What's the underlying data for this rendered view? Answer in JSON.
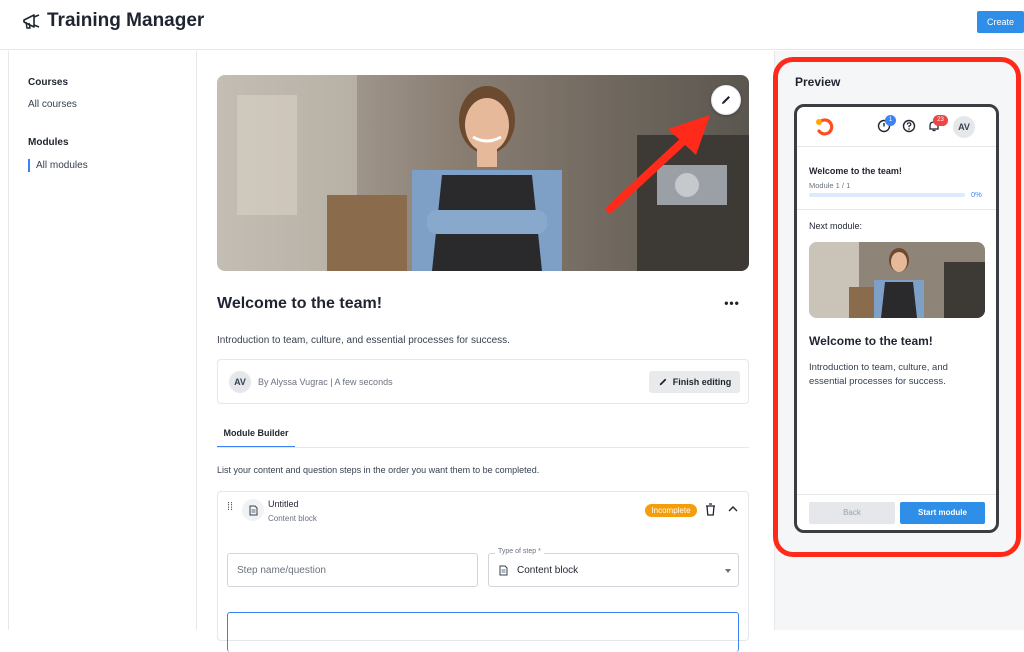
{
  "app": {
    "title": "Training Manager",
    "create_label": "Create"
  },
  "sidebar": {
    "courses_heading": "Courses",
    "courses_item": "All courses",
    "modules_heading": "Modules",
    "modules_item": "All modules"
  },
  "module": {
    "title": "Welcome to the team!",
    "more_label": "•••",
    "description": "Introduction to team, culture, and essential processes for success.",
    "author_initials": "AV",
    "author_meta": "By Alyssa Vugrac | A few seconds",
    "finish_label": "Finish editing"
  },
  "builder": {
    "tab_label": "Module Builder",
    "hint": "List your content and question steps in the order you want them to be completed.",
    "step": {
      "name": "Untitled",
      "type": "Content block",
      "status": "Incomplete",
      "name_placeholder": "Step name/question",
      "type_label": "Type of step *",
      "type_value": "Content block"
    }
  },
  "preview": {
    "heading": "Preview",
    "avatar": "AV",
    "notif_count_1": "1",
    "notif_count_2": "23",
    "welcome": "Welcome to the team!",
    "module_count": "Module 1 / 1",
    "progress_pct": "0%",
    "progress_value": 0,
    "next_label": "Next module:",
    "card_title": "Welcome to the team!",
    "card_desc": "Introduction to team, culture, and essential processes for success.",
    "back_label": "Back",
    "start_label": "Start module"
  },
  "colors": {
    "accent": "#2f8fe8",
    "highlight": "#ff2a1a",
    "badge": "#f59e0b"
  }
}
